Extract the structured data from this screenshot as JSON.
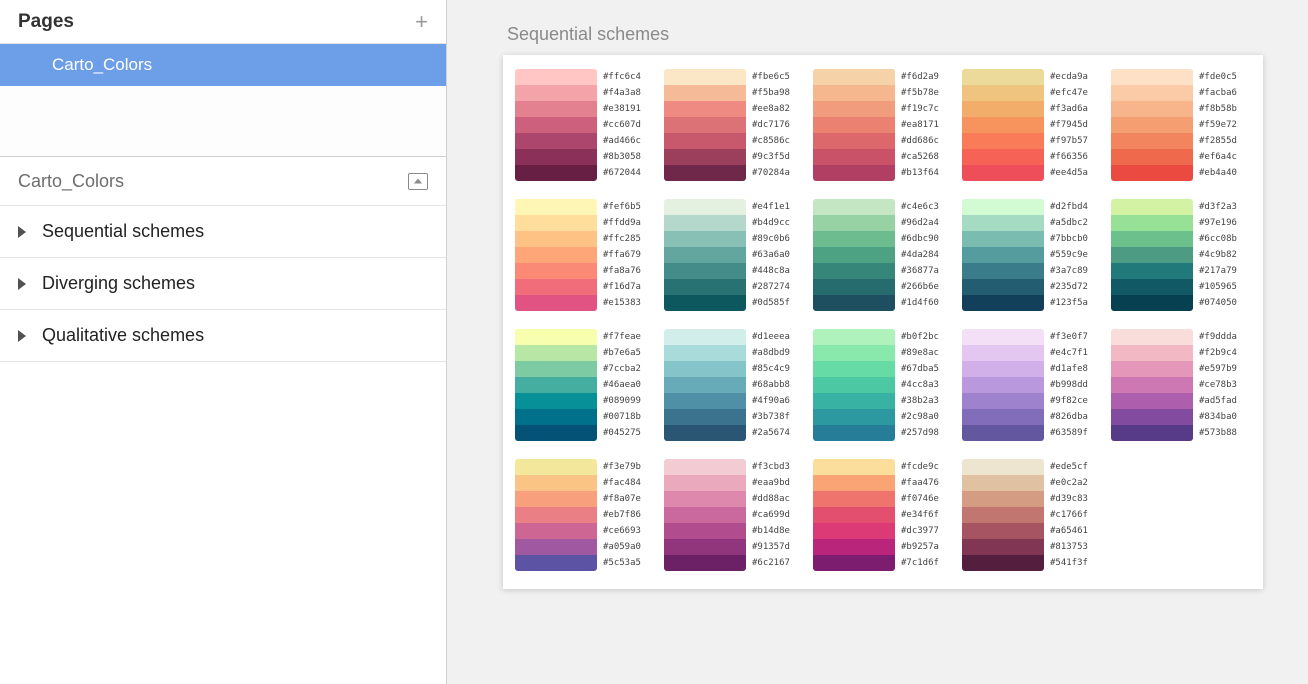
{
  "sidebar": {
    "pages_header": "Pages",
    "page_name": "Carto_Colors",
    "layers_header": "Carto_Colors",
    "layers": [
      {
        "label": "Sequential schemes"
      },
      {
        "label": "Diverging schemes"
      },
      {
        "label": "Qualitative schemes"
      }
    ]
  },
  "artboard": {
    "title": "Sequential schemes"
  },
  "schemes": [
    [
      "#ffc6c4",
      "#f4a3a8",
      "#e38191",
      "#cc607d",
      "#ad466c",
      "#8b3058",
      "#672044"
    ],
    [
      "#fbe6c5",
      "#f5ba98",
      "#ee8a82",
      "#dc7176",
      "#c8586c",
      "#9c3f5d",
      "#70284a"
    ],
    [
      "#f6d2a9",
      "#f5b78e",
      "#f19c7c",
      "#ea8171",
      "#dd686c",
      "#ca5268",
      "#b13f64"
    ],
    [
      "#ecda9a",
      "#efc47e",
      "#f3ad6a",
      "#f7945d",
      "#f97b57",
      "#f66356",
      "#ee4d5a"
    ],
    [
      "#fde0c5",
      "#facba6",
      "#f8b58b",
      "#f59e72",
      "#f2855d",
      "#ef6a4c",
      "#eb4a40"
    ],
    [
      "#fef6b5",
      "#ffdd9a",
      "#ffc285",
      "#ffa679",
      "#fa8a76",
      "#f16d7a",
      "#e15383"
    ],
    [
      "#e4f1e1",
      "#b4d9cc",
      "#89c0b6",
      "#63a6a0",
      "#448c8a",
      "#287274",
      "#0d585f"
    ],
    [
      "#c4e6c3",
      "#96d2a4",
      "#6dbc90",
      "#4da284",
      "#36877a",
      "#266b6e",
      "#1d4f60"
    ],
    [
      "#d2fbd4",
      "#a5dbc2",
      "#7bbcb0",
      "#559c9e",
      "#3a7c89",
      "#235d72",
      "#123f5a"
    ],
    [
      "#d3f2a3",
      "#97e196",
      "#6cc08b",
      "#4c9b82",
      "#217a79",
      "#105965",
      "#074050"
    ],
    [
      "#f7feae",
      "#b7e6a5",
      "#7ccba2",
      "#46aea0",
      "#089099",
      "#00718b",
      "#045275"
    ],
    [
      "#d1eeea",
      "#a8dbd9",
      "#85c4c9",
      "#68abb8",
      "#4f90a6",
      "#3b738f",
      "#2a5674"
    ],
    [
      "#b0f2bc",
      "#89e8ac",
      "#67dba5",
      "#4cc8a3",
      "#38b2a3",
      "#2c98a0",
      "#257d98"
    ],
    [
      "#f3e0f7",
      "#e4c7f1",
      "#d1afe8",
      "#b998dd",
      "#9f82ce",
      "#826dba",
      "#63589f"
    ],
    [
      "#f9ddda",
      "#f2b9c4",
      "#e597b9",
      "#ce78b3",
      "#ad5fad",
      "#834ba0",
      "#573b88"
    ],
    [
      "#f3e79b",
      "#fac484",
      "#f8a07e",
      "#eb7f86",
      "#ce6693",
      "#a059a0",
      "#5c53a5"
    ],
    [
      "#f3cbd3",
      "#eaa9bd",
      "#dd88ac",
      "#ca699d",
      "#b14d8e",
      "#91357d",
      "#6c2167"
    ],
    [
      "#fcde9c",
      "#faa476",
      "#f0746e",
      "#e34f6f",
      "#dc3977",
      "#b9257a",
      "#7c1d6f"
    ],
    [
      "#ede5cf",
      "#e0c2a2",
      "#d39c83",
      "#c1766f",
      "#a65461",
      "#813753",
      "#541f3f"
    ]
  ]
}
